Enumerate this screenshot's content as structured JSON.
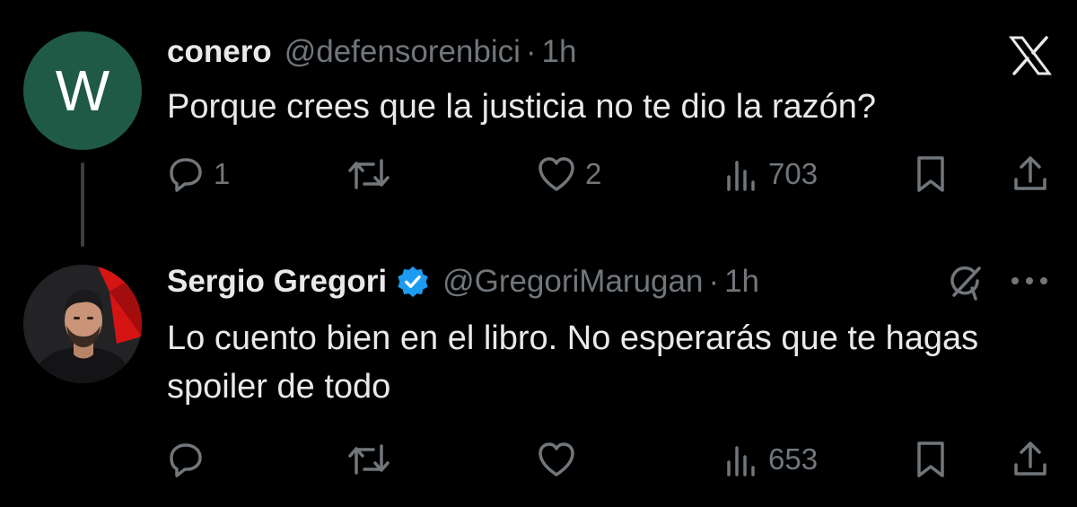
{
  "tweets": [
    {
      "avatar_letter": "W",
      "display_name": "conero",
      "handle": "@defensorenbici",
      "separator": "·",
      "time": "1h",
      "text": "Porque crees que la justicia no te dio la razón?",
      "reply_count": "1",
      "like_count": "2",
      "view_count": "703"
    },
    {
      "display_name": "Sergio Gregori",
      "verified": true,
      "handle": "@GregoriMarugan",
      "separator": "·",
      "time": "1h",
      "text": "Lo cuento bien en el libro. No esperarás que te hagas spoiler de todo",
      "reply_count": "",
      "like_count": "",
      "view_count": "653"
    }
  ],
  "colors": {
    "background": "#000000",
    "text_primary": "#e7e9ea",
    "text_secondary": "#71767b",
    "verified_blue": "#1d9bf0",
    "avatar_green": "#1f5a47"
  }
}
